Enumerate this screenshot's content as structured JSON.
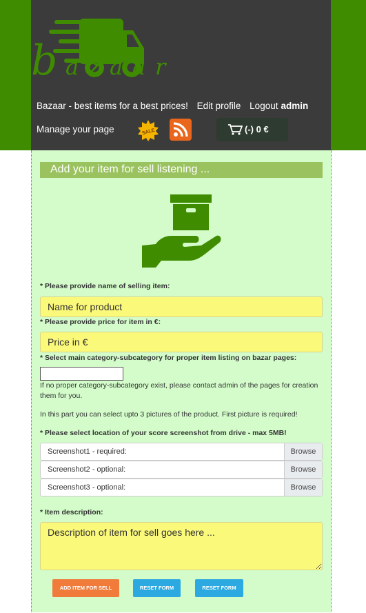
{
  "header": {
    "logo_text": "bazaar",
    "tagline": "Bazaar - best items for a best prices!",
    "edit_profile": "Edit profile",
    "logout_label": "Logout",
    "logout_user": "admin",
    "manage_page": "Manage your page",
    "sale_badge": "SALE",
    "cart_text": "(-) 0 €",
    "brand_color": "#3f8c00"
  },
  "form": {
    "title": "Add your item for sell listening ...",
    "name_label": "* Please provide name of selling item:",
    "name_placeholder": "Name for product",
    "price_label": "* Please provide price for item in €:",
    "price_placeholder": "Price in €",
    "category_label": "* Select main category-subcategory for proper item listing on bazar pages:",
    "category_note": "If no proper category-subcategory exist, please contact admin of the pages for creation them for you.",
    "pictures_note": "In this part you can select upto 3 pictures of the product. First picture is required!",
    "location_label": "* Please select location of your score screenshot from drive - max 5MB!",
    "files": [
      {
        "label": "Screenshot1 - required:",
        "button": "Browse"
      },
      {
        "label": "Screenshot2 - optional:",
        "button": "Browse"
      },
      {
        "label": "Screenshot3 - optional:",
        "button": "Browse"
      }
    ],
    "description_label": "* Item description:",
    "description_placeholder": "Description of item for sell goes here ...",
    "add_button": "ADD ITEM FOR SELL",
    "reset_button_1": "RESET FORM",
    "reset_button_2": "RESET FORM"
  }
}
